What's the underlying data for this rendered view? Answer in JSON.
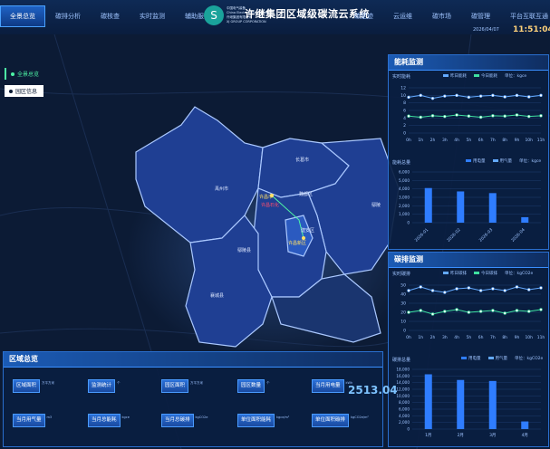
{
  "header": {
    "title": "许继集团区域级碳流云系统",
    "logo_text_1": "中国电气装备",
    "logo_text_2": "China Electrical Equipment",
    "logo_text_3": "许继集团有限公司",
    "logo_text_4": "XJ GROUP CORPORATION",
    "date": "2026/04/07",
    "time": "11:51:04",
    "nav_left": [
      "全景总览",
      "碳排分析",
      "碳核查",
      "实时监测",
      "辅助服务"
    ],
    "nav_right": [
      "碳足迹",
      "云运维",
      "碳市场",
      "碳管理",
      "平台互联互通"
    ]
  },
  "side_tabs": {
    "overview": "全景总览",
    "region": "园区信息"
  },
  "map": {
    "labels": [
      "魏都区",
      "建安区",
      "许昌市",
      "许昌石化",
      "许昌新区",
      "襄城县",
      "鄢陵县",
      "长葛市",
      "禹州市",
      "鄢陵"
    ]
  },
  "energy_panel": {
    "title": "能耗监测",
    "realtime_title": "实时能耗",
    "legend_a": "昨日能耗",
    "legend_b": "今日能耗",
    "unit": "单位：kgce",
    "yticks": [
      "12",
      "10",
      "8",
      "6",
      "4",
      "2",
      "0"
    ],
    "xticks": [
      "0h",
      "1h",
      "2h",
      "3h",
      "4h",
      "5h",
      "6h",
      "7h",
      "8h",
      "9h",
      "10h",
      "11h"
    ],
    "total_title": "能耗总量",
    "legend_c": "用电量",
    "legend_d": "用气量",
    "unit2": "单位：kgce",
    "yticks2": [
      "6,000",
      "5,000",
      "4,000",
      "3,000",
      "2,000",
      "1,000",
      "0"
    ],
    "xticks2": [
      "2026-01",
      "2026-02",
      "2026-03",
      "2026-04"
    ]
  },
  "carbon_panel": {
    "title": "碳排监测",
    "realtime_title": "实时碳排",
    "legend_a": "昨日碳排",
    "legend_b": "今日碳排",
    "unit": "单位：kgCO2e",
    "yticks": [
      "50",
      "40",
      "30",
      "20",
      "10",
      "0"
    ],
    "xticks": [
      "0h",
      "1h",
      "2h",
      "3h",
      "4h",
      "5h",
      "6h",
      "7h",
      "8h",
      "9h",
      "10h",
      "11h"
    ],
    "total_title": "碳排总量",
    "legend_c": "用电量",
    "legend_d": "用气量",
    "unit2": "单位：kgCO2e",
    "yticks2": [
      "18,000",
      "16,000",
      "14,000",
      "12,000",
      "10,000",
      "8,000",
      "6,000",
      "4,000",
      "2,000",
      "0"
    ],
    "xticks2": [
      "1月",
      "2月",
      "3月",
      "4月"
    ]
  },
  "region_panel": {
    "title": "区域总览",
    "stats": [
      {
        "label": "区域面积",
        "unit": "万平方米"
      },
      {
        "label": "监测统计",
        "unit": "个"
      },
      {
        "label": "园区面积",
        "unit": "万平方米"
      },
      {
        "label": "园区数量",
        "unit": "个"
      },
      {
        "label": "当月用电量",
        "unit": "kWh"
      },
      {
        "label": "当月用气量",
        "unit": "m3"
      },
      {
        "label": "当月总能耗",
        "unit": "kgce"
      },
      {
        "label": "当月总碳排",
        "unit": "kgCO2e"
      },
      {
        "label": "单位面积能耗",
        "unit": "kgce/m²"
      },
      {
        "label": "单位面积碳排",
        "unit": "kgCO2e/m²"
      }
    ],
    "power_value": "2513.04"
  },
  "chart_data": [
    {
      "type": "line",
      "title": "实时能耗",
      "x": [
        "0h",
        "1h",
        "2h",
        "3h",
        "4h",
        "5h",
        "6h",
        "7h",
        "8h",
        "9h",
        "10h",
        "11h"
      ],
      "ylim": [
        0,
        12
      ],
      "series": [
        {
          "name": "昨日能耗",
          "values": [
            9.5,
            10,
            9.2,
            9.8,
            10,
            9.5,
            9.8,
            10,
            9.6,
            10,
            9.6,
            10
          ]
        },
        {
          "name": "今日能耗",
          "values": [
            4.5,
            4.2,
            4.6,
            4.4,
            4.8,
            4.5,
            4.2,
            4.6,
            4.5,
            4.8,
            4.4,
            4.6
          ]
        }
      ]
    },
    {
      "type": "bar",
      "title": "能耗总量",
      "categories": [
        "2026-01",
        "2026-02",
        "2026-03",
        "2026-04"
      ],
      "ylim": [
        0,
        6000
      ],
      "series": [
        {
          "name": "用电量",
          "values": [
            4100,
            3700,
            3500,
            650
          ]
        },
        {
          "name": "用气量",
          "values": [
            0,
            0,
            0,
            0
          ]
        }
      ]
    },
    {
      "type": "line",
      "title": "实时碳排",
      "x": [
        "0h",
        "1h",
        "2h",
        "3h",
        "4h",
        "5h",
        "6h",
        "7h",
        "8h",
        "9h",
        "10h",
        "11h"
      ],
      "ylim": [
        0,
        50
      ],
      "series": [
        {
          "name": "昨日碳排",
          "values": [
            44,
            48,
            44,
            42,
            46,
            47,
            44,
            46,
            44,
            48,
            45,
            47
          ]
        },
        {
          "name": "今日碳排",
          "values": [
            20,
            22,
            18,
            21,
            23,
            20,
            21,
            22,
            19,
            22,
            21,
            23
          ]
        }
      ]
    },
    {
      "type": "bar",
      "title": "碳排总量",
      "categories": [
        "1月",
        "2月",
        "3月",
        "4月"
      ],
      "ylim": [
        0,
        18000
      ],
      "series": [
        {
          "name": "用电量",
          "values": [
            16500,
            14800,
            14500,
            2300
          ]
        },
        {
          "name": "用气量",
          "values": [
            0,
            0,
            0,
            0
          ]
        }
      ]
    }
  ]
}
